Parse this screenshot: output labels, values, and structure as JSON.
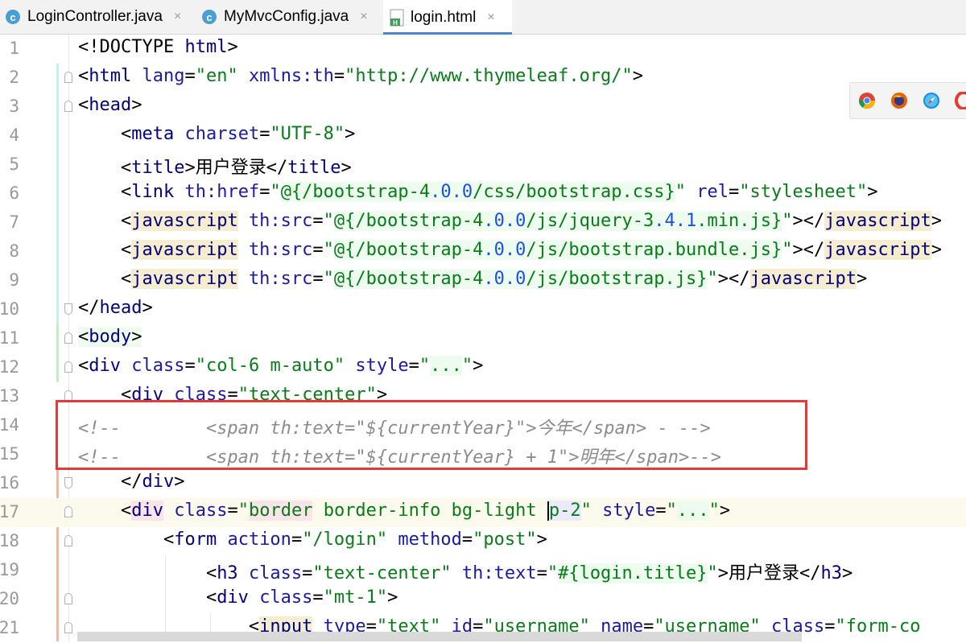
{
  "tabs": [
    {
      "label": "LoginController.java",
      "icon": "java-class-icon",
      "close": "×"
    },
    {
      "label": "MyMvcConfig.java",
      "icon": "java-class-icon",
      "close": "×"
    },
    {
      "label": "login.html",
      "icon": "html-file-icon",
      "close": "×"
    }
  ],
  "gutter": {
    "line_numbers": [
      "1",
      "2",
      "3",
      "4",
      "5",
      "6",
      "7",
      "8",
      "9",
      "10",
      "11",
      "12",
      "13",
      "14",
      "15",
      "16",
      "17",
      "18",
      "19",
      "20",
      "21"
    ]
  },
  "browser_icons": [
    "chrome-icon",
    "firefox-icon",
    "safari-icon",
    "opera-icon"
  ],
  "colors": {
    "tag": "#000080",
    "attr": "#1a1aa6",
    "value": "#067d17",
    "number": "#1750eb",
    "comment": "#8c8c8c",
    "highlight_box": "#e53935",
    "tab_accent": "#4a88c7"
  }
}
